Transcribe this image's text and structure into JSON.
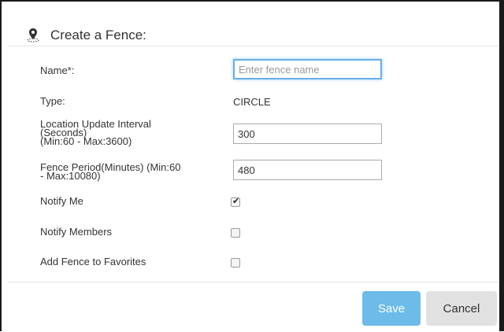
{
  "dialog": {
    "title": "Create a Fence:",
    "title_icon": "location-pin-icon"
  },
  "form": {
    "name": {
      "label": "Name*:",
      "value": "",
      "placeholder": "Enter fence name"
    },
    "type": {
      "label": "Type:",
      "value": "CIRCLE"
    },
    "location_update_interval": {
      "label_line1": "Location Update Interval",
      "label_line2": "(Seconds)",
      "label_line3": "(Min:60 - Max:3600)",
      "value": "300"
    },
    "fence_period": {
      "label_line1": "Fence Period(Minutes) (Min:60",
      "label_line2": "- Max:10080)",
      "value": "480"
    },
    "notify_me": {
      "label": "Notify Me",
      "checked": true
    },
    "notify_members": {
      "label": "Notify Members",
      "checked": false
    },
    "add_to_favorites": {
      "label": "Add Fence to Favorites",
      "checked": false
    }
  },
  "footer": {
    "save_label": "Save",
    "cancel_label": "Cancel"
  },
  "colors": {
    "save_button": "#6cbbe9",
    "cancel_button": "#e1e1e1",
    "focus_border": "#66afe9"
  },
  "checkbox_tick": "✔"
}
